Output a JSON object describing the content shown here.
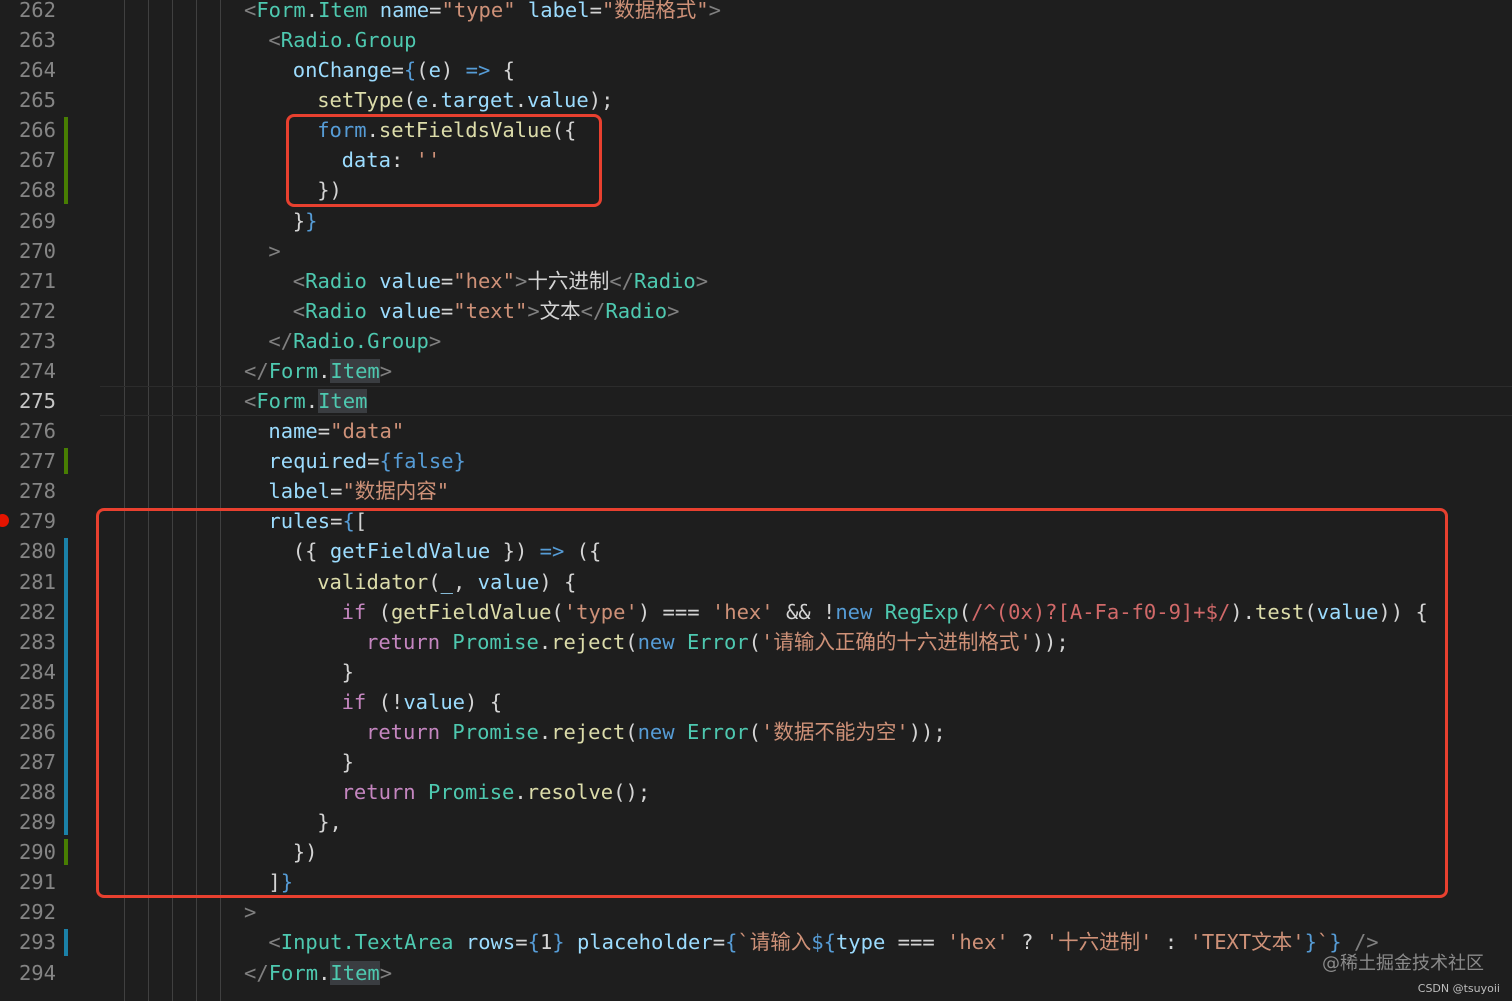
{
  "editor": {
    "active_line": "275",
    "breakpoint_line": "279",
    "lines": [
      {
        "no": "262",
        "tokens": [
          {
            "t": "tag",
            "v": "<"
          },
          {
            "t": "comp",
            "v": "Form"
          },
          {
            "t": "plain",
            "v": "."
          },
          {
            "t": "comp",
            "v": "Item"
          },
          {
            "t": "plain",
            "v": " "
          },
          {
            "t": "attr",
            "v": "name"
          },
          {
            "t": "plain",
            "v": "="
          },
          {
            "t": "str",
            "v": "\"type\""
          },
          {
            "t": "plain",
            "v": " "
          },
          {
            "t": "attr",
            "v": "label"
          },
          {
            "t": "plain",
            "v": "="
          },
          {
            "t": "str",
            "v": "\"数据格式\""
          },
          {
            "t": "tag",
            "v": ">"
          }
        ]
      },
      {
        "no": "263",
        "tokens": [
          {
            "t": "tag",
            "v": "<"
          },
          {
            "t": "comp",
            "v": "Radio.Group"
          }
        ]
      },
      {
        "no": "264",
        "tokens": [
          {
            "t": "attr",
            "v": "onChange"
          },
          {
            "t": "plain",
            "v": "="
          },
          {
            "t": "brace",
            "v": "{"
          },
          {
            "t": "plain",
            "v": "("
          },
          {
            "t": "var",
            "v": "e"
          },
          {
            "t": "plain",
            "v": ") "
          },
          {
            "t": "kw",
            "v": "=>"
          },
          {
            "t": "plain",
            "v": " {"
          }
        ]
      },
      {
        "no": "265",
        "tokens": [
          {
            "t": "fn",
            "v": "setType"
          },
          {
            "t": "plain",
            "v": "("
          },
          {
            "t": "var",
            "v": "e"
          },
          {
            "t": "plain",
            "v": "."
          },
          {
            "t": "var",
            "v": "target"
          },
          {
            "t": "plain",
            "v": "."
          },
          {
            "t": "var",
            "v": "value"
          },
          {
            "t": "plain",
            "v": ");"
          }
        ]
      },
      {
        "no": "266",
        "tokens": [
          {
            "t": "kw",
            "v": "form"
          },
          {
            "t": "plain",
            "v": "."
          },
          {
            "t": "fn",
            "v": "setFieldsValue"
          },
          {
            "t": "plain",
            "v": "({"
          }
        ]
      },
      {
        "no": "267",
        "tokens": [
          {
            "t": "var",
            "v": "data"
          },
          {
            "t": "plain",
            "v": ": "
          },
          {
            "t": "str",
            "v": "''"
          }
        ]
      },
      {
        "no": "268",
        "tokens": [
          {
            "t": "plain",
            "v": "})"
          }
        ]
      },
      {
        "no": "269",
        "tokens": [
          {
            "t": "plain",
            "v": "}"
          },
          {
            "t": "brace",
            "v": "}"
          }
        ]
      },
      {
        "no": "270",
        "tokens": [
          {
            "t": "tag",
            "v": ">"
          }
        ]
      },
      {
        "no": "271",
        "tokens": [
          {
            "t": "tag",
            "v": "<"
          },
          {
            "t": "comp",
            "v": "Radio"
          },
          {
            "t": "plain",
            "v": " "
          },
          {
            "t": "attr",
            "v": "value"
          },
          {
            "t": "plain",
            "v": "="
          },
          {
            "t": "str",
            "v": "\"hex\""
          },
          {
            "t": "tag",
            "v": ">"
          },
          {
            "t": "text",
            "v": "十六进制"
          },
          {
            "t": "tag",
            "v": "</"
          },
          {
            "t": "comp",
            "v": "Radio"
          },
          {
            "t": "tag",
            "v": ">"
          }
        ]
      },
      {
        "no": "272",
        "tokens": [
          {
            "t": "tag",
            "v": "<"
          },
          {
            "t": "comp",
            "v": "Radio"
          },
          {
            "t": "plain",
            "v": " "
          },
          {
            "t": "attr",
            "v": "value"
          },
          {
            "t": "plain",
            "v": "="
          },
          {
            "t": "str",
            "v": "\"text\""
          },
          {
            "t": "tag",
            "v": ">"
          },
          {
            "t": "text",
            "v": "文本"
          },
          {
            "t": "tag",
            "v": "</"
          },
          {
            "t": "comp",
            "v": "Radio"
          },
          {
            "t": "tag",
            "v": ">"
          }
        ]
      },
      {
        "no": "273",
        "tokens": [
          {
            "t": "tag",
            "v": "</"
          },
          {
            "t": "comp",
            "v": "Radio.Group"
          },
          {
            "t": "tag",
            "v": ">"
          }
        ]
      },
      {
        "no": "274",
        "tokens": [
          {
            "t": "tag",
            "v": "</"
          },
          {
            "t": "comp",
            "v": "Form"
          },
          {
            "t": "plain",
            "v": "."
          },
          {
            "t": "comphl",
            "v": "Item"
          },
          {
            "t": "tag",
            "v": ">"
          }
        ]
      },
      {
        "no": "275",
        "tokens": [
          {
            "t": "tag",
            "v": "<"
          },
          {
            "t": "comp",
            "v": "Form"
          },
          {
            "t": "plain",
            "v": "."
          },
          {
            "t": "comphl",
            "v": "Item"
          }
        ]
      },
      {
        "no": "276",
        "tokens": [
          {
            "t": "attr",
            "v": "name"
          },
          {
            "t": "plain",
            "v": "="
          },
          {
            "t": "str",
            "v": "\"data\""
          }
        ]
      },
      {
        "no": "277",
        "tokens": [
          {
            "t": "attr",
            "v": "required"
          },
          {
            "t": "plain",
            "v": "="
          },
          {
            "t": "brace",
            "v": "{"
          },
          {
            "t": "kw",
            "v": "false"
          },
          {
            "t": "brace",
            "v": "}"
          }
        ]
      },
      {
        "no": "278",
        "tokens": [
          {
            "t": "attr",
            "v": "label"
          },
          {
            "t": "plain",
            "v": "="
          },
          {
            "t": "str",
            "v": "\"数据内容\""
          }
        ]
      },
      {
        "no": "279",
        "tokens": [
          {
            "t": "attr",
            "v": "rules"
          },
          {
            "t": "plain",
            "v": "="
          },
          {
            "t": "brace",
            "v": "{"
          },
          {
            "t": "plain",
            "v": "["
          }
        ]
      },
      {
        "no": "280",
        "tokens": [
          {
            "t": "plain",
            "v": "({ "
          },
          {
            "t": "var",
            "v": "getFieldValue"
          },
          {
            "t": "plain",
            "v": " }) "
          },
          {
            "t": "kw",
            "v": "=>"
          },
          {
            "t": "plain",
            "v": " ({"
          }
        ]
      },
      {
        "no": "281",
        "tokens": [
          {
            "t": "fn",
            "v": "validator"
          },
          {
            "t": "plain",
            "v": "("
          },
          {
            "t": "var",
            "v": "_"
          },
          {
            "t": "plain",
            "v": ", "
          },
          {
            "t": "var",
            "v": "value"
          },
          {
            "t": "plain",
            "v": ") {"
          }
        ]
      },
      {
        "no": "282",
        "tokens": [
          {
            "t": "ctrl",
            "v": "if"
          },
          {
            "t": "plain",
            "v": " ("
          },
          {
            "t": "fn",
            "v": "getFieldValue"
          },
          {
            "t": "plain",
            "v": "("
          },
          {
            "t": "str",
            "v": "'type'"
          },
          {
            "t": "plain",
            "v": ") === "
          },
          {
            "t": "str",
            "v": "'hex'"
          },
          {
            "t": "plain",
            "v": " && !"
          },
          {
            "t": "kw",
            "v": "new"
          },
          {
            "t": "plain",
            "v": " "
          },
          {
            "t": "class",
            "v": "RegExp"
          },
          {
            "t": "plain",
            "v": "("
          },
          {
            "t": "regex",
            "v": "/^(0x)?[A-Fa-f0-9]+$/"
          },
          {
            "t": "plain",
            "v": ")."
          },
          {
            "t": "fn",
            "v": "test"
          },
          {
            "t": "plain",
            "v": "("
          },
          {
            "t": "var",
            "v": "value"
          },
          {
            "t": "plain",
            "v": ")) {"
          }
        ]
      },
      {
        "no": "283",
        "tokens": [
          {
            "t": "ctrl",
            "v": "return"
          },
          {
            "t": "plain",
            "v": " "
          },
          {
            "t": "class",
            "v": "Promise"
          },
          {
            "t": "plain",
            "v": "."
          },
          {
            "t": "fn",
            "v": "reject"
          },
          {
            "t": "plain",
            "v": "("
          },
          {
            "t": "kw",
            "v": "new"
          },
          {
            "t": "plain",
            "v": " "
          },
          {
            "t": "class",
            "v": "Error"
          },
          {
            "t": "plain",
            "v": "("
          },
          {
            "t": "str",
            "v": "'请输入正确的十六进制格式'"
          },
          {
            "t": "plain",
            "v": "));"
          }
        ]
      },
      {
        "no": "284",
        "tokens": [
          {
            "t": "plain",
            "v": "}"
          }
        ]
      },
      {
        "no": "285",
        "tokens": [
          {
            "t": "ctrl",
            "v": "if"
          },
          {
            "t": "plain",
            "v": " (!"
          },
          {
            "t": "var",
            "v": "value"
          },
          {
            "t": "plain",
            "v": ") {"
          }
        ]
      },
      {
        "no": "286",
        "tokens": [
          {
            "t": "ctrl",
            "v": "return"
          },
          {
            "t": "plain",
            "v": " "
          },
          {
            "t": "class",
            "v": "Promise"
          },
          {
            "t": "plain",
            "v": "."
          },
          {
            "t": "fn",
            "v": "reject"
          },
          {
            "t": "plain",
            "v": "("
          },
          {
            "t": "kw",
            "v": "new"
          },
          {
            "t": "plain",
            "v": " "
          },
          {
            "t": "class",
            "v": "Error"
          },
          {
            "t": "plain",
            "v": "("
          },
          {
            "t": "str",
            "v": "'数据不能为空'"
          },
          {
            "t": "plain",
            "v": "));"
          }
        ]
      },
      {
        "no": "287",
        "tokens": [
          {
            "t": "plain",
            "v": "}"
          }
        ]
      },
      {
        "no": "288",
        "tokens": [
          {
            "t": "ctrl",
            "v": "return"
          },
          {
            "t": "plain",
            "v": " "
          },
          {
            "t": "class",
            "v": "Promise"
          },
          {
            "t": "plain",
            "v": "."
          },
          {
            "t": "fn",
            "v": "resolve"
          },
          {
            "t": "plain",
            "v": "();"
          }
        ]
      },
      {
        "no": "289",
        "tokens": [
          {
            "t": "plain",
            "v": "},"
          }
        ]
      },
      {
        "no": "290",
        "tokens": [
          {
            "t": "plain",
            "v": "})"
          }
        ]
      },
      {
        "no": "291",
        "tokens": [
          {
            "t": "plain",
            "v": "]"
          },
          {
            "t": "brace",
            "v": "}"
          }
        ]
      },
      {
        "no": "292",
        "tokens": [
          {
            "t": "tag",
            "v": ">"
          }
        ]
      },
      {
        "no": "293",
        "tokens": [
          {
            "t": "tag",
            "v": "<"
          },
          {
            "t": "comp",
            "v": "Input.TextArea"
          },
          {
            "t": "plain",
            "v": " "
          },
          {
            "t": "attr",
            "v": "rows"
          },
          {
            "t": "plain",
            "v": "="
          },
          {
            "t": "brace",
            "v": "{"
          },
          {
            "t": "plain",
            "v": "1"
          },
          {
            "t": "brace",
            "v": "}"
          },
          {
            "t": "plain",
            "v": " "
          },
          {
            "t": "attr",
            "v": "placeholder"
          },
          {
            "t": "plain",
            "v": "="
          },
          {
            "t": "brace",
            "v": "{"
          },
          {
            "t": "str",
            "v": "`请输入"
          },
          {
            "t": "brace",
            "v": "${"
          },
          {
            "t": "var",
            "v": "type"
          },
          {
            "t": "plain",
            "v": " === "
          },
          {
            "t": "str",
            "v": "'hex'"
          },
          {
            "t": "plain",
            "v": " ? "
          },
          {
            "t": "str",
            "v": "'十六进制'"
          },
          {
            "t": "plain",
            "v": " : "
          },
          {
            "t": "str",
            "v": "'TEXT文本'"
          },
          {
            "t": "brace",
            "v": "}"
          },
          {
            "t": "str",
            "v": "`"
          },
          {
            "t": "brace",
            "v": "}"
          },
          {
            "t": "plain",
            "v": " "
          },
          {
            "t": "tag",
            "v": "/>"
          }
        ]
      },
      {
        "no": "294",
        "tokens": [
          {
            "t": "tag",
            "v": "</"
          },
          {
            "t": "comp",
            "v": "Form"
          },
          {
            "t": "plain",
            "v": "."
          },
          {
            "t": "comphl",
            "v": "Item"
          },
          {
            "t": "tag",
            "v": ">"
          }
        ]
      }
    ]
  },
  "watermark": {
    "text": "@稀土掘金技术社区",
    "credit": "CSDN @tsuyoii"
  },
  "colors": {
    "background": "#1e1e1e",
    "annotation_box": "#e8402f",
    "breakpoint": "#e51400",
    "diff_modified": "#1b81a8",
    "diff_added": "#487e02"
  }
}
